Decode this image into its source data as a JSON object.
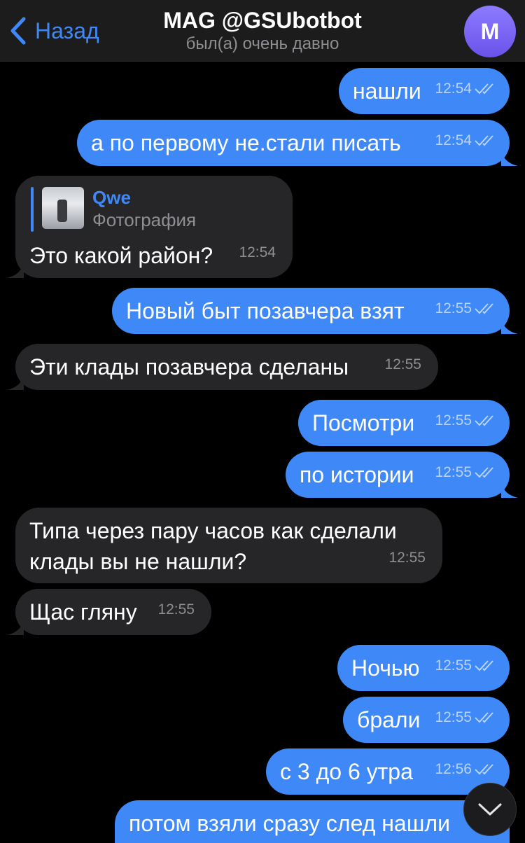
{
  "header": {
    "back_label": "Назад",
    "title": "MAG @GSUbotbot",
    "status": "был(а) очень давно",
    "avatar_letter": "M"
  },
  "messages": [
    {
      "direction": "out",
      "text": "нашли",
      "time": "12:54",
      "read": true
    },
    {
      "direction": "out",
      "text": "а по первому не.стали писать",
      "time": "12:54",
      "read": true
    },
    {
      "direction": "in",
      "text": "Это какой район?",
      "time": "12:54",
      "reply": {
        "name": "Qwe",
        "type": "Фотография"
      }
    },
    {
      "direction": "out",
      "text": "Новый быт позавчера взят",
      "time": "12:55",
      "read": true
    },
    {
      "direction": "in",
      "text": "Эти клады позавчера сделаны",
      "time": "12:55"
    },
    {
      "direction": "out",
      "text": "Посмотри",
      "time": "12:55",
      "read": true
    },
    {
      "direction": "out",
      "text": "по истории",
      "time": "12:55",
      "read": true
    },
    {
      "direction": "in",
      "text_line1": "Типа через пару часов как сделали",
      "text_line2": "клады вы не нашли?",
      "time": "12:55"
    },
    {
      "direction": "in",
      "text": "Щас гляну",
      "time": "12:55"
    },
    {
      "direction": "out",
      "text": "Ночью",
      "time": "12:55",
      "read": true
    },
    {
      "direction": "out",
      "text": "брали",
      "time": "12:55",
      "read": true
    },
    {
      "direction": "out",
      "text": "с 3 до 6 утра",
      "time": "12:56",
      "read": true
    },
    {
      "direction": "out",
      "text": "потом взяли сразу след нашли",
      "time": "",
      "read": true
    }
  ],
  "colors": {
    "outgoing_bubble": "#3e88f7",
    "incoming_bubble": "#262628",
    "background": "#000000",
    "accent": "#3e88f7"
  },
  "icons": {
    "back": "chevron-left-icon",
    "read": "double-check-icon",
    "scroll_down": "chevron-down-icon"
  }
}
